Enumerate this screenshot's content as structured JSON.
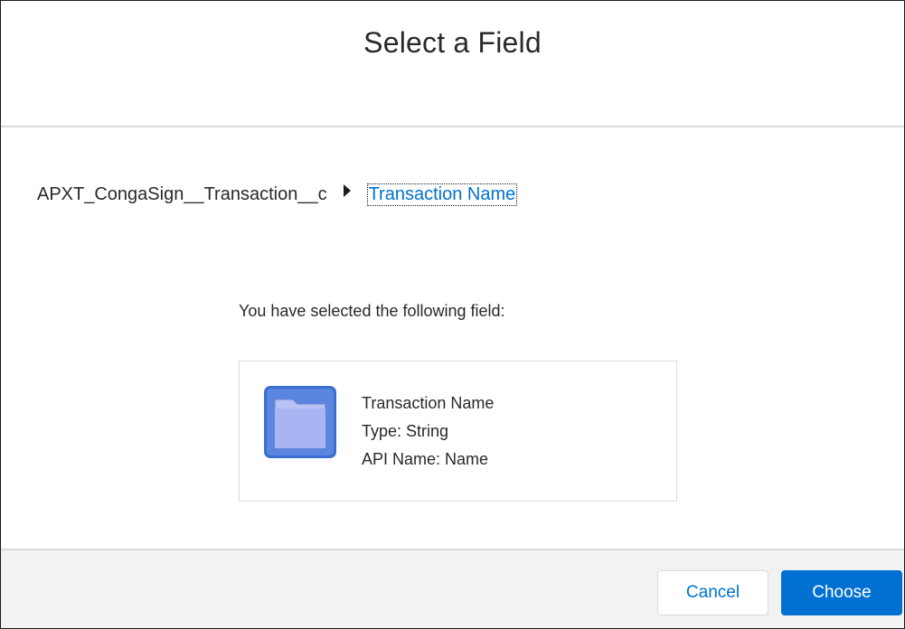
{
  "header": {
    "title": "Select a Field"
  },
  "breadcrumb": {
    "root": "APXT_CongaSign__Transaction__c",
    "current": "Transaction Name"
  },
  "selection": {
    "label": "You have selected the following field:",
    "field_label": "Transaction Name",
    "type_line": "Type: String",
    "api_line": "API Name: Name",
    "icon": "folder-icon"
  },
  "footer": {
    "cancel_label": "Cancel",
    "choose_label": "Choose"
  },
  "colors": {
    "brand_blue": "#0070d2",
    "text": "#2b2826",
    "border": "#dddbda",
    "footer_bg": "#f3f2f2"
  }
}
